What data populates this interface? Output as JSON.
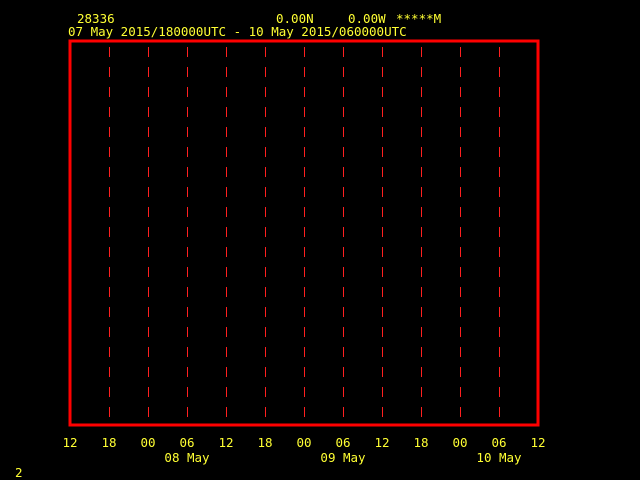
{
  "header": {
    "station_id": "28336",
    "latitude": "0.00N",
    "longitude": "0.00W",
    "elevation": "*****M",
    "time_range": "07 May 2015/180000UTC - 10 May 2015/060000UTC"
  },
  "page_number": "2",
  "colors": {
    "background": "#000000",
    "frame": "#ff0000",
    "gridline": "#ff2020",
    "text": "#ffff33"
  },
  "chart_data": {
    "type": "line",
    "title": "",
    "xlabel": "",
    "ylabel": "",
    "x_range": [
      "2015-05-07 12:00 UTC",
      "2015-05-10 12:00 UTC"
    ],
    "x_tick_labels": [
      "12",
      "18",
      "00",
      "06",
      "12",
      "18",
      "00",
      "06",
      "12",
      "18",
      "00",
      "06",
      "12"
    ],
    "x_tick_hours_from_start": [
      0,
      6,
      12,
      18,
      24,
      30,
      36,
      42,
      48,
      54,
      60,
      66,
      72
    ],
    "date_labels": [
      {
        "text": "08 May",
        "at_hour": 18
      },
      {
        "text": "09 May",
        "at_hour": 42
      },
      {
        "text": "10 May",
        "at_hour": 66
      }
    ],
    "gridlines_at_hours": [
      6,
      12,
      18,
      24,
      30,
      36,
      42,
      48,
      54,
      60,
      66
    ],
    "grid": "vertical-dashed",
    "series": []
  }
}
